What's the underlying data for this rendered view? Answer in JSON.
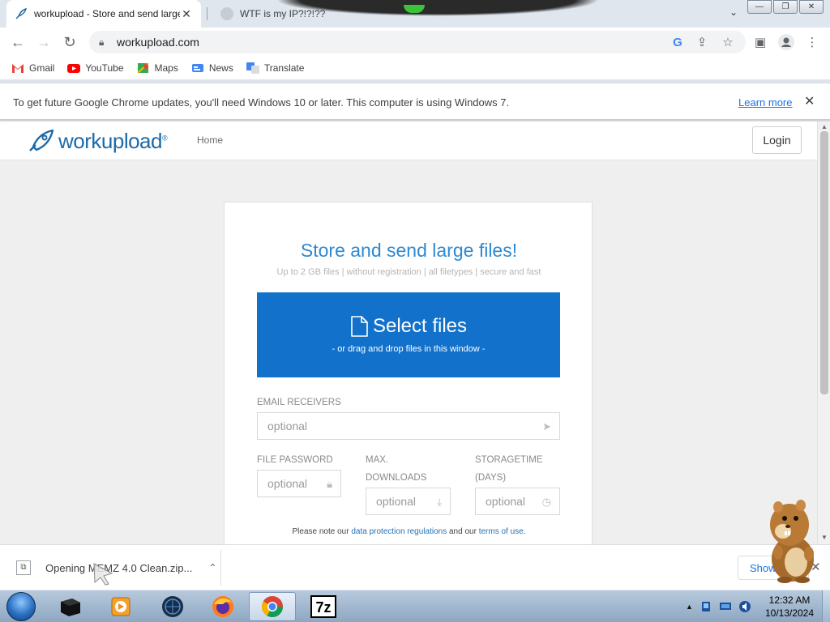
{
  "browser": {
    "tabs": [
      {
        "title": "workupload - Store and send large files",
        "active": true,
        "close": "✕"
      },
      {
        "title": "WTF is my IP?!?!??",
        "active": false
      }
    ],
    "tab_search_icon": "chevron-down-icon",
    "address": "workupload.com",
    "bookmarks": [
      "Gmail",
      "YouTube",
      "Maps",
      "News",
      "Translate"
    ],
    "infobar": {
      "message": "To get future Google Chrome updates, you'll need Windows 10 or later. This computer is using Windows 7.",
      "link": "Learn more",
      "close": "✕"
    }
  },
  "site": {
    "logo_text": "workupload",
    "logo_reg": "®",
    "nav_home": "Home",
    "login": "Login",
    "card": {
      "title": "Store and send large files!",
      "subtitle": "Up to 2 GB files | without registration | all filetypes | secure and fast",
      "select_label": "Select files",
      "select_sub": "- or drag and drop files in this window -",
      "email_label": "EMAIL RECEIVERS",
      "email_placeholder": "optional",
      "password_label": "FILE PASSWORD",
      "password_placeholder": "optional",
      "downloads_label": "MAX. DOWNLOADS",
      "downloads_placeholder": "optional",
      "storage_label": "STORAGETIME (DAYS)",
      "storage_placeholder": "optional",
      "note_prefix": "Please note our",
      "note_link1": "data protection regulations",
      "note_middle": "and our",
      "note_link2": "terms of use",
      "note_suffix": "."
    }
  },
  "download_bar": {
    "item": "Opening MEMZ 4.0 Clean.zip...",
    "show_all": "Show all"
  },
  "taskbar": {
    "time": "12:32 AM",
    "date": "10/13/2024"
  },
  "colors": {
    "accent_blue": "#1271cb",
    "title_blue": "#2e89d1",
    "logo_blue": "#1c6aa8"
  }
}
